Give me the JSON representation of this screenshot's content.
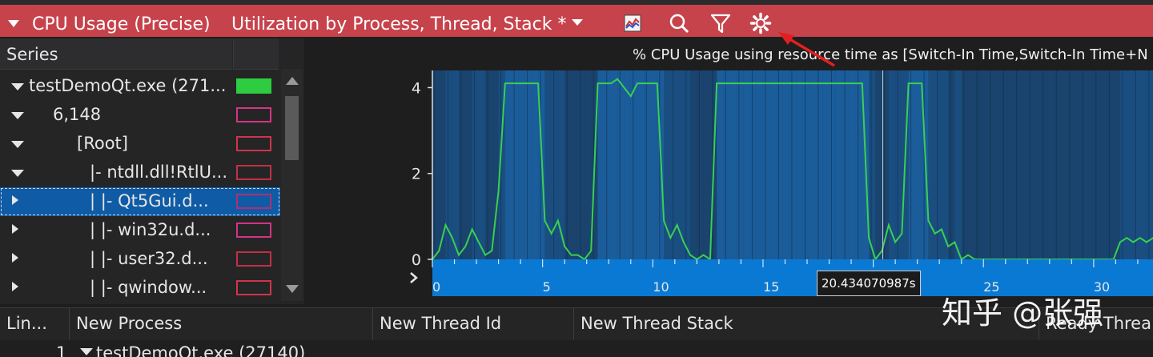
{
  "titlebar": {
    "graph_name": "CPU Usage (Precise)",
    "preset": "Utilization by Process, Thread, Stack *",
    "icons": [
      "chart-series-icon",
      "search-icon",
      "filter-icon",
      "settings-gear-icon"
    ]
  },
  "series_panel": {
    "header": "Series",
    "rows": [
      {
        "label": "testDemoQt.exe (271...",
        "expanded": true,
        "swatch": "#2ecc40",
        "filled": true
      },
      {
        "label": "6,148",
        "expanded": true,
        "swatch": "#d63384",
        "filled": false
      },
      {
        "label": "[Root]",
        "expanded": true,
        "swatch": "#d0344a",
        "filled": false
      },
      {
        "label": "|- ntdll.dll!RtlU...",
        "expanded": true,
        "swatch": "#c23045",
        "filled": false
      },
      {
        "label": "|    |- Qt5Gui.d...",
        "expanded": false,
        "swatch": "#b03070",
        "filled": false,
        "selected": true
      },
      {
        "label": "|    |- win32u.d...",
        "expanded": false,
        "swatch": "#d63384",
        "filled": false
      },
      {
        "label": "|    |- user32.d...",
        "expanded": false,
        "swatch": "#c23045",
        "filled": false
      },
      {
        "label": "|    |- qwindow...",
        "expanded": false,
        "swatch": "#d0344a",
        "filled": false
      }
    ]
  },
  "chart": {
    "title": "% CPU Usage using resource time as [Switch-In Time,Switch-In Time+N",
    "cursor_tooltip": "20.434070987s"
  },
  "chart_data": {
    "type": "line",
    "title": "% CPU Usage using resource time as [Switch-In Time,Switch-In Time+N",
    "y_ticks": [
      "0",
      "2",
      "4"
    ],
    "ylim": [
      0,
      4.4
    ],
    "x_ticks": [
      "0",
      "5",
      "10",
      "15",
      "20",
      "25",
      "30"
    ],
    "xlim": [
      0,
      34
    ],
    "cursor_x": 20.434070987,
    "series": [
      {
        "color": "#38d050",
        "x": [
          0,
          0.3,
          0.6,
          0.9,
          1.2,
          1.5,
          1.8,
          2.1,
          2.4,
          2.7,
          3.0,
          3.3,
          3.6,
          3.9,
          4.2,
          4.5,
          4.8,
          5.1,
          5.4,
          5.7,
          6.0,
          6.3,
          6.6,
          6.9,
          7.2,
          7.5,
          7.8,
          8.1,
          8.4,
          8.7,
          9.0,
          9.3,
          9.6,
          9.9,
          10.2,
          10.5,
          10.8,
          11.1,
          11.4,
          11.7,
          12.0,
          12.3,
          12.6,
          12.9,
          13.2,
          13.5,
          13.8,
          14.1,
          14.4,
          14.7,
          15.0,
          15.3,
          15.6,
          15.9,
          16.2,
          16.5,
          16.8,
          17.1,
          17.4,
          17.7,
          18.0,
          18.3,
          18.6,
          18.9,
          19.2,
          19.5,
          19.8,
          20.1,
          20.4,
          20.7,
          21.0,
          21.3,
          21.6,
          21.9,
          22.2,
          22.5,
          22.8,
          23.1,
          23.4,
          23.7,
          24.0,
          24.3,
          24.6,
          24.9,
          25.2,
          25.5,
          25.8,
          26.1,
          26.4,
          26.7,
          27.0,
          27.3,
          27.6,
          27.9,
          28.2,
          28.5,
          28.8,
          29.1,
          29.4,
          29.7,
          30.0,
          30.3,
          30.6,
          30.9,
          31.2,
          31.5,
          31.8,
          32.1,
          32.4,
          32.7,
          33.0,
          33.3,
          33.6,
          34.0
        ],
        "y": [
          0,
          0.2,
          0.8,
          0.5,
          0.1,
          0.3,
          0.7,
          0.4,
          0.1,
          0.2,
          1.6,
          4.1,
          4.1,
          4.1,
          4.1,
          4.1,
          4.1,
          0.9,
          0.6,
          0.9,
          0.3,
          0.1,
          0.1,
          0.0,
          0.2,
          4.1,
          4.1,
          4.1,
          4.2,
          4.0,
          3.8,
          4.1,
          4.1,
          4.1,
          4.1,
          0.9,
          0.5,
          0.8,
          0.4,
          0.1,
          0.0,
          0.1,
          0.0,
          4.1,
          4.1,
          4.1,
          4.1,
          4.1,
          4.1,
          4.1,
          4.1,
          4.1,
          4.1,
          4.1,
          4.1,
          4.1,
          4.1,
          4.1,
          4.1,
          4.1,
          4.1,
          4.1,
          4.1,
          4.1,
          4.1,
          4.1,
          0.5,
          0.0,
          0.2,
          0.8,
          0.4,
          0.6,
          4.1,
          4.1,
          4.1,
          0.9,
          0.6,
          0.7,
          0.3,
          0.4,
          0.0,
          0.1,
          0.0,
          0.0,
          0.0,
          0.0,
          0.0,
          0.0,
          0.0,
          0.0,
          0.0,
          0.0,
          0.0,
          0.0,
          0.0,
          0.0,
          0.0,
          0.0,
          0.0,
          0.0,
          0.0,
          0.0,
          0.0,
          0.0,
          0.4,
          0.5,
          0.4,
          0.5,
          0.4,
          0.5,
          0.5,
          0.4,
          0.1,
          0.0
        ]
      }
    ],
    "shading_color": "#1b5f9e",
    "axis_bar_color": "#0a79d4"
  },
  "grid": {
    "columns": [
      "Lin...",
      "New Process",
      "New Thread Id",
      "New Thread Stack",
      "Ready Threa"
    ],
    "first_row": {
      "line": "1",
      "process": "testDemoQt.exe (27140)"
    }
  },
  "watermark": "知乎 @张强"
}
